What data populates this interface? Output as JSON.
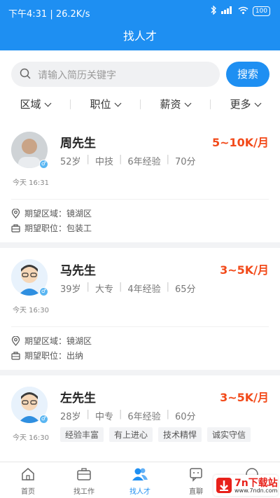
{
  "status_bar": {
    "time_speed": "下午4:31 | 26.2K/s",
    "signal": "5G",
    "battery": "100"
  },
  "header": {
    "title": "找人才"
  },
  "search": {
    "placeholder": "请输入简历关键字",
    "button": "搜索"
  },
  "filters": [
    {
      "label": "区域"
    },
    {
      "label": "职位"
    },
    {
      "label": "薪资"
    },
    {
      "label": "更多"
    }
  ],
  "candidates": [
    {
      "name": "周先生",
      "salary": "5~10K/月",
      "age": "52岁",
      "education": "中技",
      "experience": "6年经验",
      "score": "70分",
      "time": "今天 16:31",
      "area_label": "期望区域：镜湖区",
      "position_label": "期望职位：包装工"
    },
    {
      "name": "马先生",
      "salary": "3~5K/月",
      "age": "39岁",
      "education": "大专",
      "experience": "4年经验",
      "score": "65分",
      "time": "今天 16:30",
      "area_label": "期望区域：镜湖区",
      "position_label": "期望职位：出纳"
    },
    {
      "name": "左先生",
      "salary": "3~5K/月",
      "age": "28岁",
      "education": "中专",
      "experience": "6年经验",
      "score": "60分",
      "time": "今天 16:30",
      "tags": [
        "经验丰富",
        "有上进心",
        "技术精悍",
        "诚实守信"
      ]
    }
  ],
  "tabbar": [
    {
      "label": "首页",
      "icon": "home-icon"
    },
    {
      "label": "找工作",
      "icon": "briefcase-icon"
    },
    {
      "label": "找人才",
      "icon": "people-icon",
      "active": true
    },
    {
      "label": "直聊",
      "icon": "chat-icon"
    }
  ],
  "watermark": {
    "text": "7n下载站",
    "url": "www.7ndn.com"
  },
  "colors": {
    "primary": "#1e8ff2",
    "salary": "#f24a1a"
  }
}
